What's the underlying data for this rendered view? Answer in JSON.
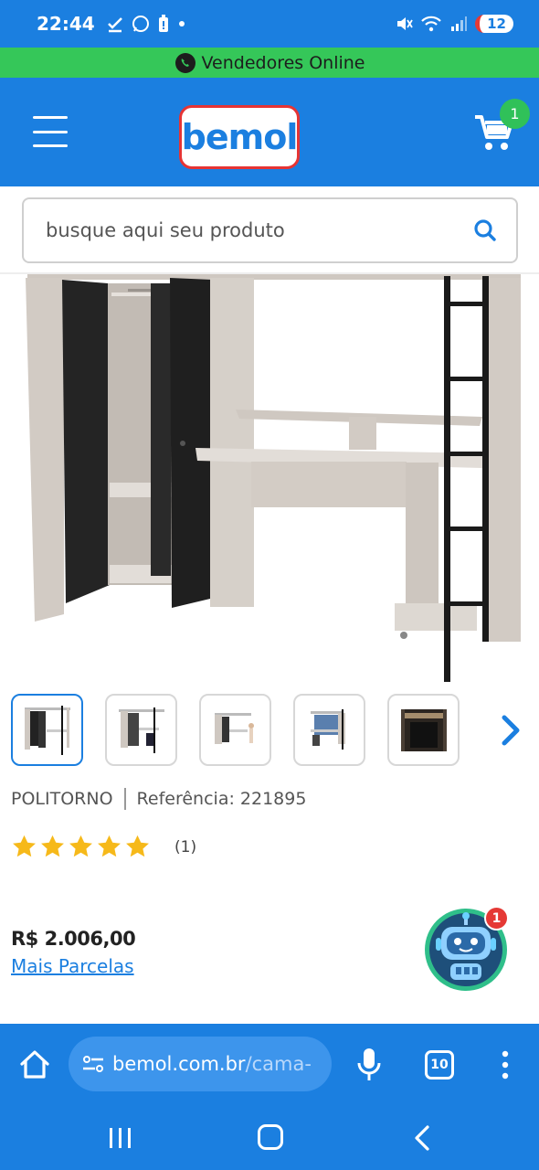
{
  "status_bar": {
    "time": "22:44",
    "battery": "12"
  },
  "promo_bar": {
    "text": "Vendedores Online"
  },
  "header": {
    "logo_text": "bemol",
    "cart_count": "1"
  },
  "search": {
    "placeholder": "busque aqui seu produto"
  },
  "product": {
    "brand": "POLITORNO",
    "reference": "Referência: 221895",
    "rating_count": "(1)",
    "rating_stars": 5,
    "price": "R$ 2.006,00",
    "installments_link": "Mais Parcelas",
    "thumbnails": [
      "thumb-1",
      "thumb-2",
      "thumb-3",
      "thumb-4",
      "thumb-5"
    ]
  },
  "assistant": {
    "badge": "1"
  },
  "browser": {
    "url_host": "bemol.com.br",
    "url_path": "/cama-",
    "tab_count": "10"
  },
  "colors": {
    "brand_blue": "#1b7fe0",
    "promo_green": "#35c759",
    "star_gold": "#f6b91a",
    "badge_red": "#e53935"
  }
}
